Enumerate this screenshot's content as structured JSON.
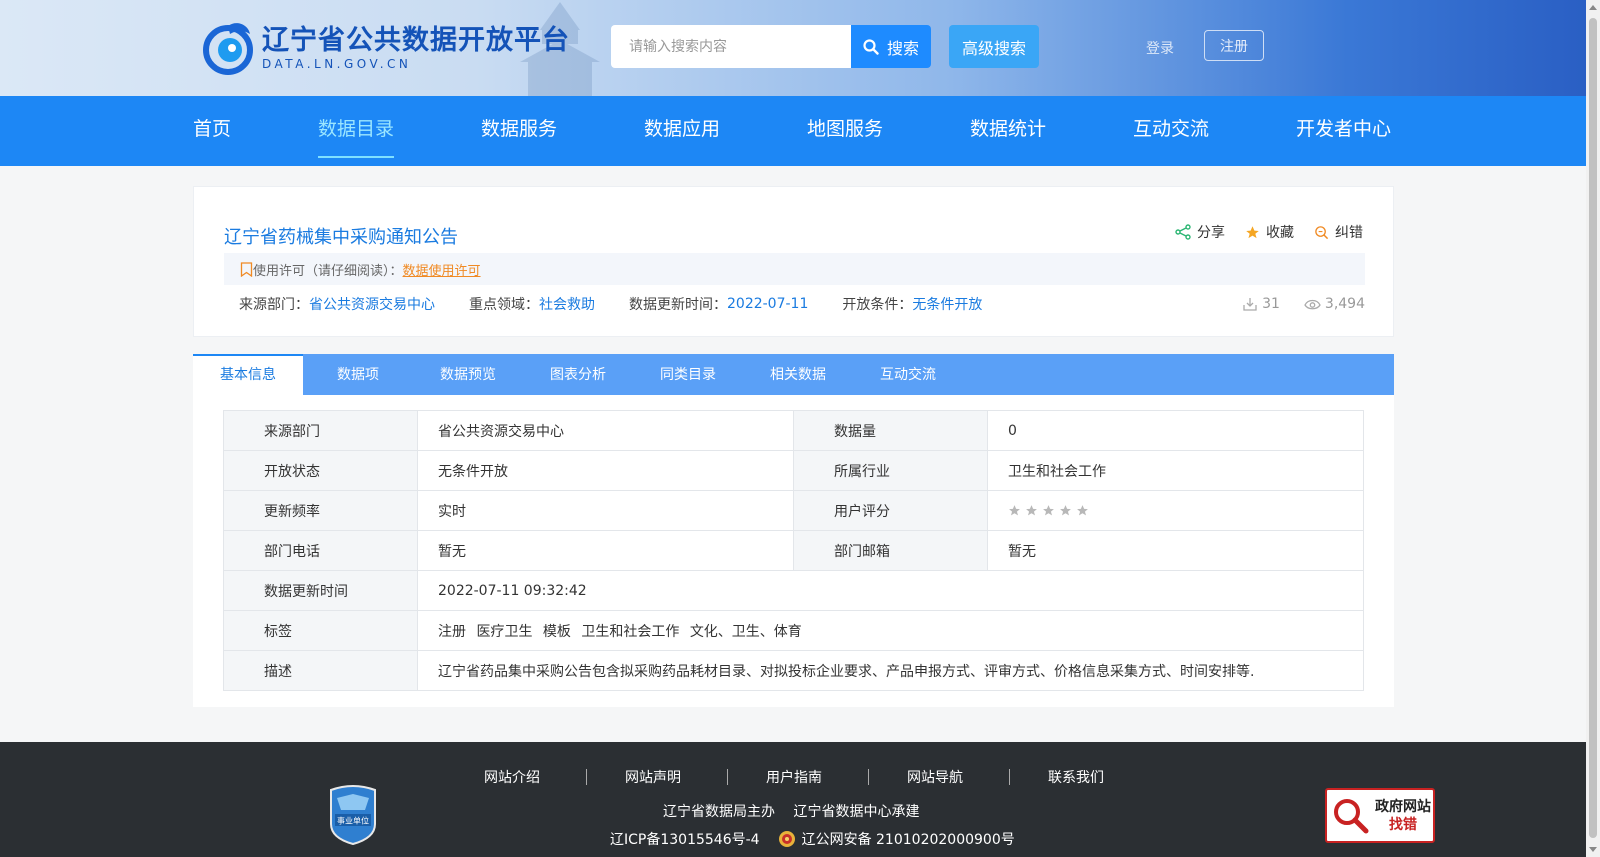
{
  "header": {
    "logo_title": "辽宁省公共数据开放平台",
    "logo_sub": "DATA.LN.GOV.CN",
    "search_placeholder": "请输入搜索内容",
    "search_label": "搜索",
    "advanced_label": "高级搜索",
    "login_label": "登录",
    "register_label": "注册"
  },
  "nav": {
    "items": [
      "首页",
      "数据目录",
      "数据服务",
      "数据应用",
      "地图服务",
      "数据统计",
      "互动交流",
      "开发者中心"
    ],
    "active": "数据目录"
  },
  "dataset": {
    "title": "辽宁省药械集中采购通知公告",
    "actions": {
      "share": "分享",
      "favorite": "收藏",
      "report": "纠错"
    },
    "license_text": "使用许可（请仔细阅读）：",
    "license_link": "数据使用许可",
    "meta": {
      "source_label": "来源部门：",
      "source_value": "省公共资源交易中心",
      "domain_label": "重点领域：",
      "domain_value": "社会救助",
      "updated_label": "数据更新时间：",
      "updated_value": "2022-07-11",
      "open_label": "开放条件：",
      "open_value": "无条件开放",
      "downloads": "31",
      "views": "3,494"
    }
  },
  "tabs": [
    "基本信息",
    "数据项",
    "数据预览",
    "图表分析",
    "同类目录",
    "相关数据",
    "互动交流"
  ],
  "info": {
    "source_dept_k": "来源部门",
    "source_dept_v": "省公共资源交易中心",
    "data_volume_k": "数据量",
    "data_volume_v": "0",
    "open_status_k": "开放状态",
    "open_status_v": "无条件开放",
    "industry_k": "所属行业",
    "industry_v": "卫生和社会工作",
    "frequency_k": "更新频率",
    "frequency_v": "实时",
    "rating_k": "用户评分",
    "rating_value": 0,
    "rating_max": 5,
    "phone_k": "部门电话",
    "phone_v": "暂无",
    "email_k": "部门邮箱",
    "email_v": "暂无",
    "update_time_k": "数据更新时间",
    "update_time_v": "2022-07-11 09:32:42",
    "tags_k": "标签",
    "tags": [
      "注册",
      "医疗卫生",
      "模板",
      "卫生和社会工作",
      "文化、卫生、体育"
    ],
    "desc_k": "描述",
    "desc_v": "辽宁省药品集中采购公告包含拟采购药品耗材目录、对拟投标企业要求、产品申报方式、评审方式、价格信息采集方式、时间安排等."
  },
  "footer": {
    "links": [
      "网站介绍",
      "网站声明",
      "用户指南",
      "网站导航",
      "联系我们"
    ],
    "sponsor": "辽宁省数据局主办",
    "builder": "辽宁省数据中心承建",
    "icp": "辽ICP备13015546号-4",
    "police": "辽公网安备 21010202000900号",
    "badge_left": "事业单位",
    "badge_right_1": "政府网站",
    "badge_right_2": "找错"
  },
  "colors": {
    "brand": "#1d87f5",
    "link": "#1a7be0",
    "accent": "#f08a24"
  }
}
